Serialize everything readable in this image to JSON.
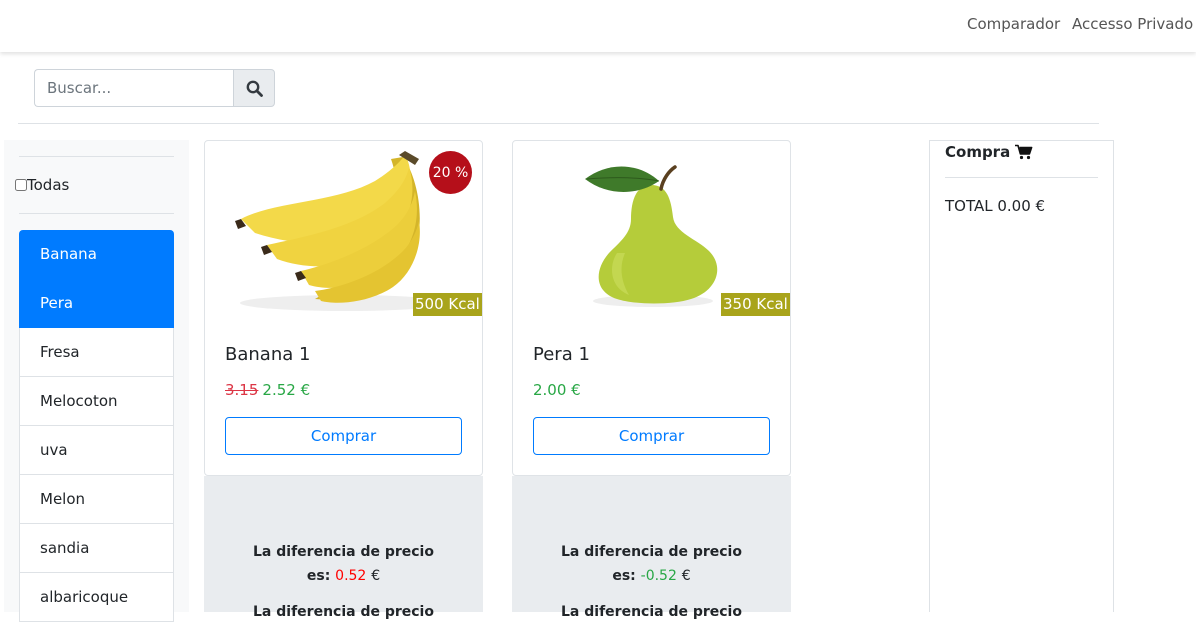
{
  "nav": {
    "links": [
      "Comparador",
      "Accesso Privado"
    ]
  },
  "search": {
    "placeholder": "Buscar..."
  },
  "sidebar": {
    "all_label": "Todas",
    "items": [
      {
        "label": "Banana",
        "active": true
      },
      {
        "label": "Pera",
        "active": true
      },
      {
        "label": "Fresa",
        "active": false
      },
      {
        "label": "Melocoton",
        "active": false
      },
      {
        "label": "uva",
        "active": false
      },
      {
        "label": "Melon",
        "active": false
      },
      {
        "label": "sandia",
        "active": false
      },
      {
        "label": "albaricoque",
        "active": false
      }
    ]
  },
  "products": [
    {
      "name": "Banana 1",
      "discount": "20 %",
      "kcal": "500 Kcal",
      "old_price": "3.15",
      "price": "2.52 €",
      "buy_label": "Comprar",
      "diff_label_1": "La diferencia de precio",
      "diff_es": "es:",
      "diff_value": "0.52",
      "diff_currency": "€",
      "diff_label_2": "La diferencia de precio"
    },
    {
      "name": "Pera 1",
      "kcal": "350 Kcal",
      "price": "2.00 €",
      "buy_label": "Comprar",
      "diff_label_1": "La diferencia de precio",
      "diff_es": "es:",
      "diff_value": "-0.52",
      "diff_currency": "€",
      "diff_label_2": "La diferencia de precio"
    }
  ],
  "cart": {
    "title": "Compra",
    "total": "TOTAL 0.00 €"
  },
  "colors": {
    "primary": "#007bff",
    "discount": "#b50f1a",
    "kcal": "#a9a41b",
    "price_green": "#28a745",
    "price_red": "#dc3545"
  }
}
